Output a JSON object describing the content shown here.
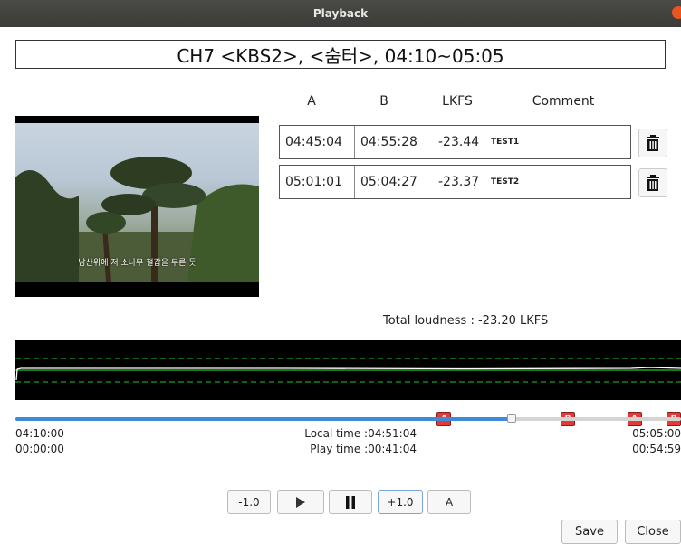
{
  "window": {
    "title": "Playback"
  },
  "header": {
    "program": "CH7 <KBS2>, <숨터>, 04:10~05:05"
  },
  "table": {
    "columns": [
      "A",
      "B",
      "LKFS",
      "Comment"
    ],
    "rows": [
      {
        "a": "04:45:04",
        "b": "04:55:28",
        "lkfs": "-23.44",
        "comment": "TEST1"
      },
      {
        "a": "05:01:01",
        "b": "05:04:27",
        "lkfs": "-23.37",
        "comment": "TEST2"
      }
    ]
  },
  "video": {
    "subtitle": "남산위에 저 소나무 철갑을 두른 듯"
  },
  "total": {
    "text": "Total loudness : -23.20 LKFS"
  },
  "markers": [
    {
      "label": "A",
      "position": 0.644
    },
    {
      "label": "B",
      "position": 0.83
    },
    {
      "label": "A",
      "position": 0.93
    },
    {
      "label": "B",
      "position": 0.995
    }
  ],
  "timeline": {
    "progress": 0.745,
    "start_time": "04:10:00",
    "end_time": "05:05:00",
    "start_play": "00:00:00",
    "end_play": "00:54:59",
    "local_time": "Local time :04:51:04",
    "play_time": "Play time :00:41:04"
  },
  "controls": {
    "back_label": "-1.0",
    "play_icon": "play-icon",
    "pause_icon": "pause-icon",
    "forward_label": "+1.0",
    "a_label": "A"
  },
  "buttons": {
    "save": "Save",
    "close": "Close"
  },
  "colors": {
    "marker": "#e53935",
    "slider": "#3d8ad8",
    "wave_line": "#22c822"
  }
}
